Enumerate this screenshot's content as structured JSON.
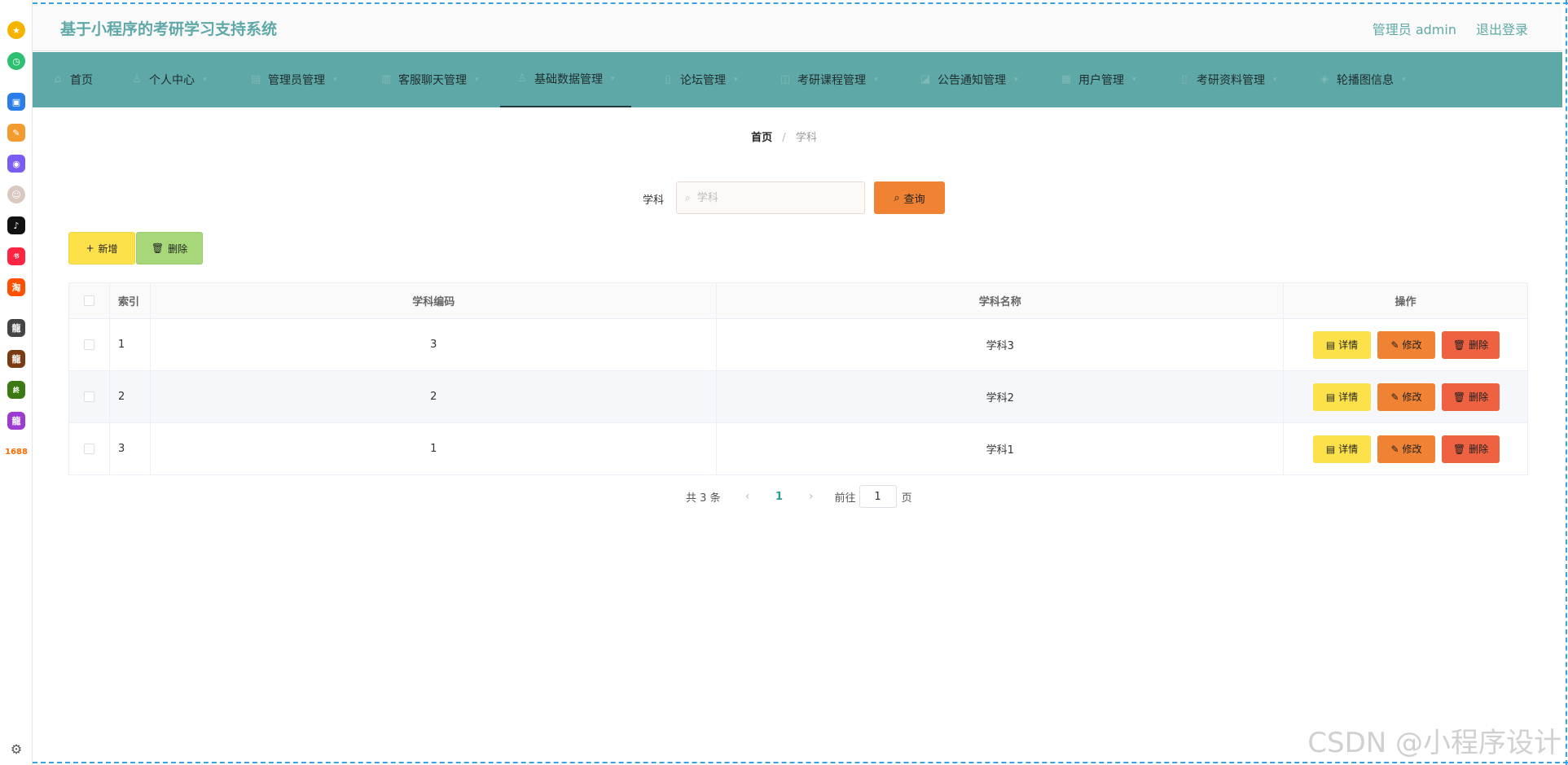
{
  "header": {
    "title": "基于小程序的考研学习支持系统",
    "user": "管理员 admin",
    "logout": "退出登录"
  },
  "nav": [
    {
      "label": "首页",
      "icon": "home-icon"
    },
    {
      "label": "个人中心",
      "icon": "user-icon"
    },
    {
      "label": "管理员管理",
      "icon": "admin-icon"
    },
    {
      "label": "客服聊天管理",
      "icon": "chat-icon"
    },
    {
      "label": "基础数据管理",
      "icon": "data-icon",
      "active": true
    },
    {
      "label": "论坛管理",
      "icon": "forum-icon"
    },
    {
      "label": "考研课程管理",
      "icon": "course-icon"
    },
    {
      "label": "公告通知管理",
      "icon": "notice-icon"
    },
    {
      "label": "用户管理",
      "icon": "users-icon"
    },
    {
      "label": "考研资料管理",
      "icon": "material-icon"
    },
    {
      "label": "轮播图信息",
      "icon": "carousel-icon"
    }
  ],
  "breadcrumb": {
    "home": "首页",
    "separator": "/",
    "current": "学科"
  },
  "search": {
    "label": "学科",
    "placeholder": "学科",
    "button": "查询"
  },
  "actions": {
    "add": "新增",
    "delete": "删除"
  },
  "table": {
    "headers": {
      "index": "索引",
      "code": "学科编码",
      "name": "学科名称",
      "ops": "操作"
    },
    "rows": [
      {
        "index": "1",
        "code": "3",
        "name": "学科3"
      },
      {
        "index": "2",
        "code": "2",
        "name": "学科2"
      },
      {
        "index": "3",
        "code": "1",
        "name": "学科1"
      }
    ],
    "op_labels": {
      "detail": "详情",
      "edit": "修改",
      "delete": "删除"
    }
  },
  "pagination": {
    "total": "共 3 条",
    "current": "1",
    "goto": "前往",
    "input": "1",
    "unit": "页"
  },
  "dock": {
    "text_item": "1688"
  },
  "watermark": "CSDN @小程序设计",
  "colors": {
    "primary": "#5ea8a7",
    "detail": "#fde14b",
    "edit": "#f08233",
    "delete": "#ee6141",
    "bulk_delete": "#a6d879"
  }
}
